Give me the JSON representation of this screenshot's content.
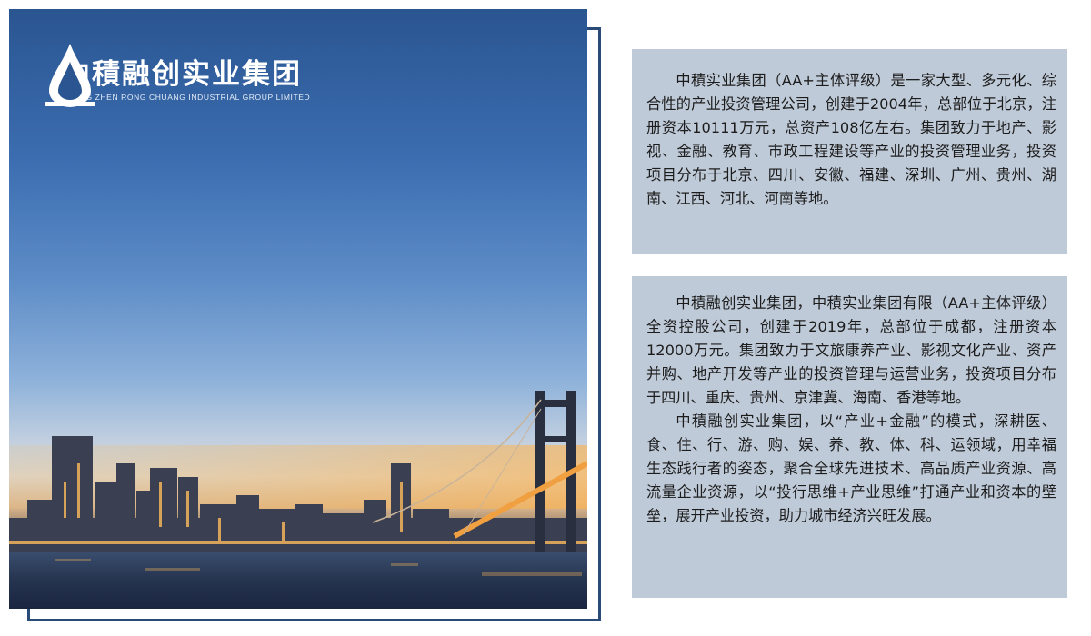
{
  "brand": {
    "name_cn": "中積融创实业集团",
    "name_en": "ZHONG ZHEN RONG CHUANG INDUSTRIAL GROUP LIMITED",
    "logo_icon": "droplet-logo-icon"
  },
  "intro_1": {
    "paragraph": "中積实业集团（AA+主体评级）是一家大型、多元化、综合性的产业投资管理公司，创建于2004年，总部位于北京，注册资本10111万元，总资产108亿左右。集团致力于地产、影视、金融、教育、市政工程建设等产业的投资管理业务，投资项目分布于北京、四川、安徽、福建、深圳、广州、贵州、湖南、江西、河北、河南等地。"
  },
  "intro_2": {
    "paragraph_1": "中積融创实业集团，中積实业集团有限（AA+主体评级）全资控股公司，创建于2019年，总部位于成都，注册资本12000万元。集团致力于文旅康养产业、影视文化产业、资产并购、地产开发等产业的投资管理与运营业务，投资项目分布于四川、重庆、贵州、京津冀、海南、香港等地。",
    "paragraph_2": "中積融创实业集团，以“产业+金融”的模式，深耕医、食、住、行、游、购、娱、养、教、体、科、运领域，用幸福生态践行者的姿态，聚合全球先进技术、高品质产业资源、高流量企业资源，以“投行思维+产业思维”打通产业和资本的壁垒，展开产业投资，助力城市经济兴旺发展。"
  },
  "colors": {
    "frame": "#2a4a78",
    "text_box_bg": "#bfcad8",
    "text": "#1c1c1c",
    "sky_top": "#2a5591",
    "city_lights": "#f2b35a"
  }
}
